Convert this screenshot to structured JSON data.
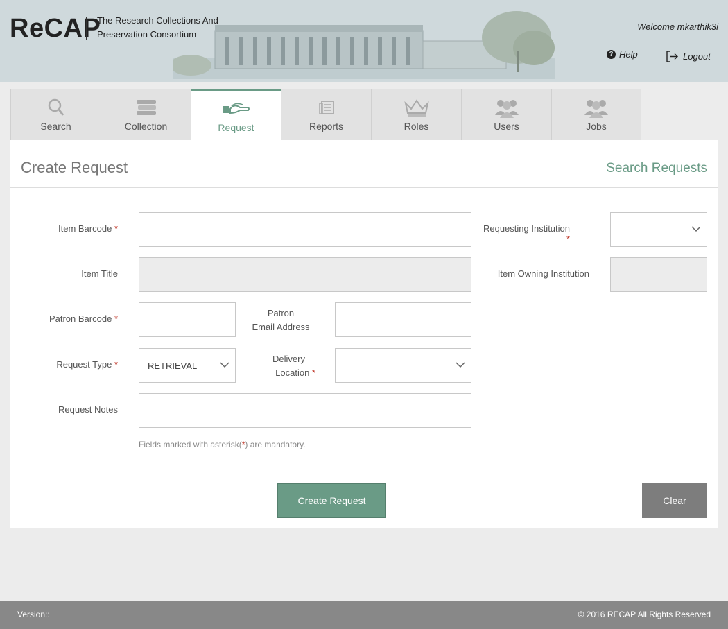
{
  "header": {
    "logo": "ReCAP",
    "tagline_line1": "The Research Collections And",
    "tagline_line2": "Preservation Consortium",
    "welcome": "Welcome mkarthik3i",
    "help": "Help",
    "logout": "Logout"
  },
  "tabs": [
    {
      "label": "Search",
      "icon": "search-icon"
    },
    {
      "label": "Collection",
      "icon": "books-icon"
    },
    {
      "label": "Request",
      "icon": "hand-book-icon",
      "active": true
    },
    {
      "label": "Reports",
      "icon": "document-icon"
    },
    {
      "label": "Roles",
      "icon": "crown-icon"
    },
    {
      "label": "Users",
      "icon": "users-icon"
    },
    {
      "label": "Jobs",
      "icon": "group-icon"
    }
  ],
  "panel": {
    "title": "Create Request",
    "search_link": "Search Requests"
  },
  "form": {
    "item_barcode_label": "Item Barcode",
    "item_barcode_value": "",
    "item_title_label": "Item Title",
    "item_title_value": "",
    "patron_barcode_label": "Patron Barcode",
    "patron_barcode_value": "",
    "patron_email_label_1": "Patron",
    "patron_email_label_2": "Email Address",
    "patron_email_value": "",
    "request_type_label": "Request Type",
    "request_type_value": "RETRIEVAL",
    "delivery_location_label_1": "Delivery",
    "delivery_location_label_2": "Location",
    "delivery_location_value": "",
    "request_notes_label": "Request Notes",
    "request_notes_value": "",
    "requesting_institution_label": "Requesting Institution",
    "requesting_institution_value": "",
    "item_owning_institution_label": "Item Owning Institution",
    "item_owning_institution_value": "",
    "required_marker": "*",
    "note_prefix": "Fields marked with asterisk(",
    "note_star": "*",
    "note_suffix": ") are mandatory."
  },
  "buttons": {
    "create": "Create Request",
    "clear": "Clear"
  },
  "footer": {
    "version": "Version::",
    "copyright": "© 2016 RECAP All Rights Reserved"
  },
  "colors": {
    "accent": "#6a9b86",
    "header_bg": "#cfd9dc",
    "footer_bg": "#888888",
    "required": "#c0392b"
  }
}
